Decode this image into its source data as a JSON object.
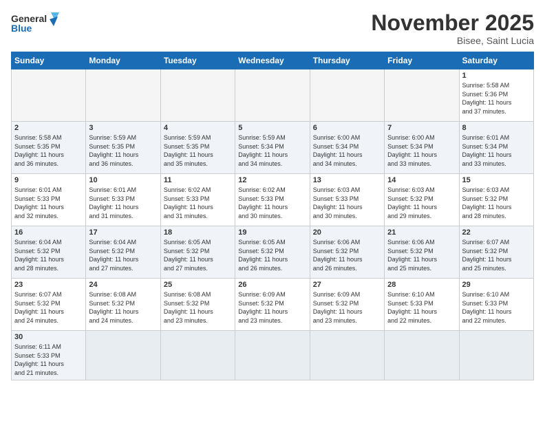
{
  "logo": {
    "general": "General",
    "blue": "Blue"
  },
  "header": {
    "month": "November 2025",
    "location": "Bisee, Saint Lucia"
  },
  "weekdays": [
    "Sunday",
    "Monday",
    "Tuesday",
    "Wednesday",
    "Thursday",
    "Friday",
    "Saturday"
  ],
  "weeks": [
    [
      {
        "day": "",
        "info": ""
      },
      {
        "day": "",
        "info": ""
      },
      {
        "day": "",
        "info": ""
      },
      {
        "day": "",
        "info": ""
      },
      {
        "day": "",
        "info": ""
      },
      {
        "day": "",
        "info": ""
      },
      {
        "day": "1",
        "info": "Sunrise: 5:58 AM\nSunset: 5:36 PM\nDaylight: 11 hours\nand 37 minutes."
      }
    ],
    [
      {
        "day": "2",
        "info": "Sunrise: 5:58 AM\nSunset: 5:35 PM\nDaylight: 11 hours\nand 36 minutes."
      },
      {
        "day": "3",
        "info": "Sunrise: 5:59 AM\nSunset: 5:35 PM\nDaylight: 11 hours\nand 36 minutes."
      },
      {
        "day": "4",
        "info": "Sunrise: 5:59 AM\nSunset: 5:35 PM\nDaylight: 11 hours\nand 35 minutes."
      },
      {
        "day": "5",
        "info": "Sunrise: 5:59 AM\nSunset: 5:34 PM\nDaylight: 11 hours\nand 34 minutes."
      },
      {
        "day": "6",
        "info": "Sunrise: 6:00 AM\nSunset: 5:34 PM\nDaylight: 11 hours\nand 34 minutes."
      },
      {
        "day": "7",
        "info": "Sunrise: 6:00 AM\nSunset: 5:34 PM\nDaylight: 11 hours\nand 33 minutes."
      },
      {
        "day": "8",
        "info": "Sunrise: 6:01 AM\nSunset: 5:34 PM\nDaylight: 11 hours\nand 33 minutes."
      }
    ],
    [
      {
        "day": "9",
        "info": "Sunrise: 6:01 AM\nSunset: 5:33 PM\nDaylight: 11 hours\nand 32 minutes."
      },
      {
        "day": "10",
        "info": "Sunrise: 6:01 AM\nSunset: 5:33 PM\nDaylight: 11 hours\nand 31 minutes."
      },
      {
        "day": "11",
        "info": "Sunrise: 6:02 AM\nSunset: 5:33 PM\nDaylight: 11 hours\nand 31 minutes."
      },
      {
        "day": "12",
        "info": "Sunrise: 6:02 AM\nSunset: 5:33 PM\nDaylight: 11 hours\nand 30 minutes."
      },
      {
        "day": "13",
        "info": "Sunrise: 6:03 AM\nSunset: 5:33 PM\nDaylight: 11 hours\nand 30 minutes."
      },
      {
        "day": "14",
        "info": "Sunrise: 6:03 AM\nSunset: 5:32 PM\nDaylight: 11 hours\nand 29 minutes."
      },
      {
        "day": "15",
        "info": "Sunrise: 6:03 AM\nSunset: 5:32 PM\nDaylight: 11 hours\nand 28 minutes."
      }
    ],
    [
      {
        "day": "16",
        "info": "Sunrise: 6:04 AM\nSunset: 5:32 PM\nDaylight: 11 hours\nand 28 minutes."
      },
      {
        "day": "17",
        "info": "Sunrise: 6:04 AM\nSunset: 5:32 PM\nDaylight: 11 hours\nand 27 minutes."
      },
      {
        "day": "18",
        "info": "Sunrise: 6:05 AM\nSunset: 5:32 PM\nDaylight: 11 hours\nand 27 minutes."
      },
      {
        "day": "19",
        "info": "Sunrise: 6:05 AM\nSunset: 5:32 PM\nDaylight: 11 hours\nand 26 minutes."
      },
      {
        "day": "20",
        "info": "Sunrise: 6:06 AM\nSunset: 5:32 PM\nDaylight: 11 hours\nand 26 minutes."
      },
      {
        "day": "21",
        "info": "Sunrise: 6:06 AM\nSunset: 5:32 PM\nDaylight: 11 hours\nand 25 minutes."
      },
      {
        "day": "22",
        "info": "Sunrise: 6:07 AM\nSunset: 5:32 PM\nDaylight: 11 hours\nand 25 minutes."
      }
    ],
    [
      {
        "day": "23",
        "info": "Sunrise: 6:07 AM\nSunset: 5:32 PM\nDaylight: 11 hours\nand 24 minutes."
      },
      {
        "day": "24",
        "info": "Sunrise: 6:08 AM\nSunset: 5:32 PM\nDaylight: 11 hours\nand 24 minutes."
      },
      {
        "day": "25",
        "info": "Sunrise: 6:08 AM\nSunset: 5:32 PM\nDaylight: 11 hours\nand 23 minutes."
      },
      {
        "day": "26",
        "info": "Sunrise: 6:09 AM\nSunset: 5:32 PM\nDaylight: 11 hours\nand 23 minutes."
      },
      {
        "day": "27",
        "info": "Sunrise: 6:09 AM\nSunset: 5:32 PM\nDaylight: 11 hours\nand 23 minutes."
      },
      {
        "day": "28",
        "info": "Sunrise: 6:10 AM\nSunset: 5:33 PM\nDaylight: 11 hours\nand 22 minutes."
      },
      {
        "day": "29",
        "info": "Sunrise: 6:10 AM\nSunset: 5:33 PM\nDaylight: 11 hours\nand 22 minutes."
      }
    ],
    [
      {
        "day": "30",
        "info": "Sunrise: 6:11 AM\nSunset: 5:33 PM\nDaylight: 11 hours\nand 21 minutes."
      },
      {
        "day": "",
        "info": ""
      },
      {
        "day": "",
        "info": ""
      },
      {
        "day": "",
        "info": ""
      },
      {
        "day": "",
        "info": ""
      },
      {
        "day": "",
        "info": ""
      },
      {
        "day": "",
        "info": ""
      }
    ]
  ]
}
